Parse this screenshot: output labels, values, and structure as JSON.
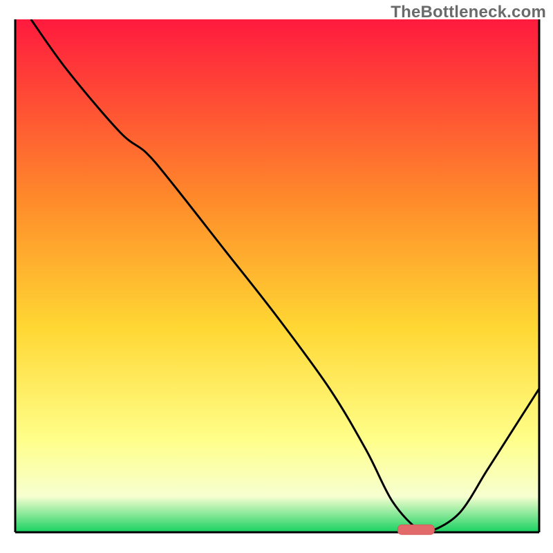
{
  "watermark": "TheBottleneck.com",
  "colors": {
    "gradient_top": "#ff1a3e",
    "gradient_mid_upper": "#ff8a2a",
    "gradient_mid": "#ffd733",
    "gradient_lower": "#ffff8a",
    "gradient_light": "#f7ffd0",
    "gradient_bottom": "#17d160",
    "curve": "#000000",
    "axis": "#000000",
    "marker_fill": "#e26a6a",
    "marker_stroke": "#d65c5c"
  },
  "chart_data": {
    "type": "line",
    "title": "",
    "xlabel": "",
    "ylabel": "",
    "xlim": [
      0,
      100
    ],
    "ylim": [
      0,
      100
    ],
    "series": [
      {
        "name": "bottleneck-curve",
        "x": [
          3,
          10,
          20,
          25,
          30,
          40,
          50,
          60,
          67,
          72,
          77,
          80,
          85,
          90,
          95,
          100
        ],
        "values": [
          100,
          90,
          78,
          74,
          68,
          55,
          42,
          28,
          16,
          6,
          0.5,
          0.5,
          4,
          12,
          20,
          28
        ]
      }
    ],
    "marker": {
      "x_start": 73,
      "x_end": 80,
      "y": 0.5
    },
    "annotations": []
  }
}
